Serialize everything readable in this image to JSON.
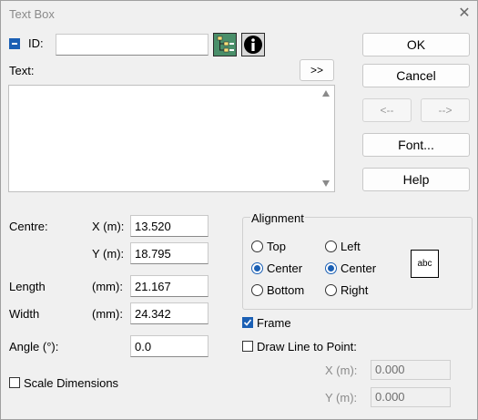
{
  "window": {
    "title": "Text Box"
  },
  "id_field": {
    "label": "ID:",
    "value": ""
  },
  "text_field": {
    "label": "Text:",
    "expand_label": ">>",
    "value": ""
  },
  "buttons": {
    "ok": "OK",
    "cancel": "Cancel",
    "prev": "<--",
    "next": "-->",
    "font": "Font...",
    "help": "Help"
  },
  "centre": {
    "label": "Centre:",
    "x_label": "X (m):",
    "x_value": "13.520",
    "y_label": "Y (m):",
    "y_value": "18.795"
  },
  "length": {
    "label": "Length",
    "unit": "(mm):",
    "value": "21.167"
  },
  "width": {
    "label": "Width",
    "unit": "(mm):",
    "value": "24.342"
  },
  "angle": {
    "label": "Angle (°):",
    "value": "0.0"
  },
  "scale_dimensions": {
    "label": "Scale Dimensions",
    "checked": false
  },
  "alignment": {
    "title": "Alignment",
    "vertical": [
      {
        "label": "Top",
        "selected": false
      },
      {
        "label": "Center",
        "selected": true
      },
      {
        "label": "Bottom",
        "selected": false
      }
    ],
    "horizontal": [
      {
        "label": "Left",
        "selected": false
      },
      {
        "label": "Center",
        "selected": true
      },
      {
        "label": "Right",
        "selected": false
      }
    ],
    "preview": "abc"
  },
  "frame": {
    "label": "Frame",
    "checked": true
  },
  "draw_line": {
    "label": "Draw Line to Point:",
    "checked": false,
    "x_label": "X (m):",
    "x_value": "0.000",
    "y_label": "Y (m):",
    "y_value": "0.000"
  },
  "colors": {
    "accent": "#1a5fb4"
  }
}
